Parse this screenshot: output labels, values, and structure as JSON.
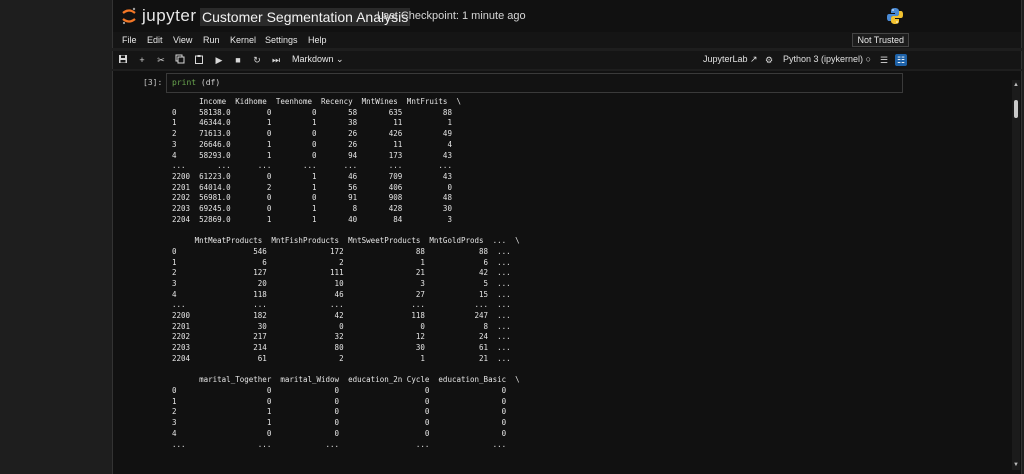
{
  "app": {
    "logo_text": "jupyter",
    "notebook_title": "Customer Segmentation Analysis",
    "checkpoint": "Last Checkpoint: 1 minute ago",
    "trust_label": "Not Trusted"
  },
  "menu": [
    "File",
    "Edit",
    "View",
    "Run",
    "Kernel",
    "Settings",
    "Help"
  ],
  "toolbar": {
    "cell_type": "Markdown",
    "jupyterlab_label": "JupyterLab",
    "kernel_label": "Python 3 (ipykernel)"
  },
  "cell": {
    "prompt": "[3]:",
    "code_keyword": "print",
    "code_rest": " (df)",
    "output_lines": [
      "      Income  Kidhome  Teenhome  Recency  MntWines  MntFruits  \\",
      "0     58138.0        0         0       58       635         88",
      "1     46344.0        1         1       38        11          1",
      "2     71613.0        0         0       26       426         49",
      "3     26646.0        1         0       26        11          4",
      "4     58293.0        1         0       94       173         43",
      "...       ...      ...       ...      ...       ...        ...",
      "2200  61223.0        0         1       46       709         43",
      "2201  64014.0        2         1       56       406          0",
      "2202  56981.0        0         0       91       908         48",
      "2203  69245.0        0         1        8       428         30",
      "2204  52869.0        1         1       40        84          3",
      "",
      "     MntMeatProducts  MntFishProducts  MntSweetProducts  MntGoldProds  ...  \\",
      "0                 546              172                88            88  ...",
      "1                   6                2                 1             6  ...",
      "2                 127              111                21            42  ...",
      "3                  20               10                 3             5  ...",
      "4                 118               46                27            15  ...",
      "...               ...              ...               ...           ...  ...",
      "2200              182               42               118           247  ...",
      "2201               30                0                 0             8  ...",
      "2202              217               32                12            24  ...",
      "2203              214               80                30            61  ...",
      "2204               61                2                 1            21  ...",
      "",
      "      marital_Together  marital_Widow  education_2n Cycle  education_Basic  \\",
      "0                    0              0                   0                0",
      "1                    0              0                   0                0",
      "2                    1              0                   0                0",
      "3                    1              0                   0                0",
      "4                    0              0                   0                0",
      "...                ...            ...                 ...              ..."
    ]
  }
}
